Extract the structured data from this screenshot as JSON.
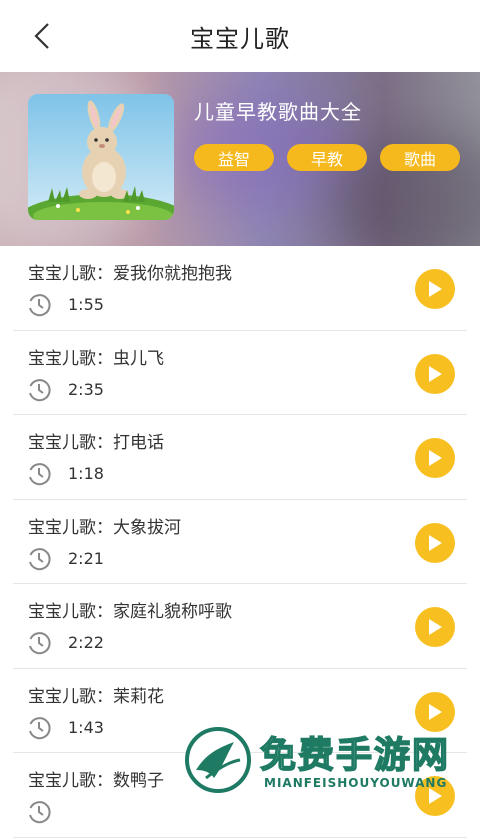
{
  "header": {
    "title": "宝宝儿歌",
    "back_icon": "chevron-left-icon"
  },
  "album": {
    "title": "儿童早教歌曲大全",
    "tags": [
      "益智",
      "早教",
      "歌曲"
    ],
    "tag_color": "#f6b91d"
  },
  "songs": [
    {
      "title": "宝宝儿歌：爱我你就抱抱我",
      "duration": "1:55"
    },
    {
      "title": "宝宝儿歌：虫儿飞",
      "duration": "2:35"
    },
    {
      "title": "宝宝儿歌：打电话",
      "duration": "1:18"
    },
    {
      "title": "宝宝儿歌：大象拔河",
      "duration": "2:21"
    },
    {
      "title": "宝宝儿歌：家庭礼貌称呼歌",
      "duration": "2:22"
    },
    {
      "title": "宝宝儿歌：茉莉花",
      "duration": "1:43"
    },
    {
      "title": "宝宝儿歌：数鸭子",
      "duration": ""
    }
  ],
  "colors": {
    "accent": "#f7bf1f",
    "watermark": "#1e7a63"
  },
  "watermark": {
    "text": "免费手游网",
    "sub": "MIANFEISHOUYOUWANG"
  }
}
